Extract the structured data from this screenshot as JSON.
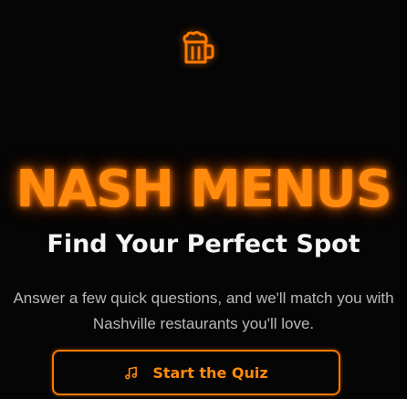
{
  "hero": {
    "icon": "beer-mug-icon",
    "title": "NASH MENUS",
    "subtitle": "Find Your Perfect Spot",
    "description_line_1": "Answer a few quick questions, and we'll match you with",
    "description_line_2": "Nashville restaurants you'll love.",
    "button": {
      "icon": "music-note-icon",
      "label": "Start the Quiz"
    }
  },
  "colors": {
    "background": "#050505",
    "accent": "#FF7A00",
    "title": "#FF8A0D",
    "subtitle": "#F4F4F4",
    "description": "#B9B9B9"
  }
}
